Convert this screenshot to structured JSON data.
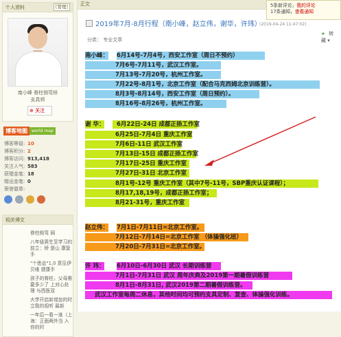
{
  "sidebar": {
    "profile_title": "个人资料",
    "manage_label": "[管理]",
    "user_caption_1": "南小峰  脊柱侧弯矫",
    "user_caption_2": "支具师",
    "follow_label": "关注",
    "blogmap_label": "博客地图",
    "blogmap_sub": "world map",
    "stats": [
      {
        "k": "博客等级:",
        "v": "10"
      },
      {
        "k": "博客积分:",
        "v": "2"
      },
      {
        "k": "博客访问:",
        "v": "913,418"
      },
      {
        "k": "关注人气:",
        "v": "583"
      },
      {
        "k": "获赠金笔:",
        "v": "18"
      },
      {
        "k": "赠出金笔:",
        "v": "0"
      },
      {
        "k": "荣誉徽章:",
        "v": ""
      }
    ],
    "related_title": "相关博文",
    "related": [
      "脊柱侧弯 网",
      "八年级男生至学习的前立：矫 是山 康复手",
      "\"个悉会\"1,0 意见伊贝维 健康手",
      "孩子的脊柱，父母需要多少了 上对心处理 与西医双",
      "大学开启新增加的时立我的视听 最新",
      "一年后一看一准（上海：正面两外当 入你的时"
    ]
  },
  "main": {
    "header_label": "正文",
    "title": "2019年7月-8月行程（南小峰，赵立伟，谢华，许玮）",
    "meta": "(2019-04-24 11:47:02)",
    "tag_label": "分类：  专业文章",
    "notice": {
      "line1a": "5条新评论，",
      "line1b": "我的评论",
      "line2a": "17条通知，",
      "line2b": "查看通知"
    }
  },
  "schedule": {
    "nan": {
      "name": "南小峰：",
      "items": [
        "6月14号-7月4号，西安工作室（周日不预约）",
        "7月6号-7月11号，武汉工作室。",
        "7月13号-7月20号，杭州工作室。",
        "7月22号-8月1号，北京工作室（配合马克西姆北京训练营）。",
        "8月3号-8月14号，西安工作室（周日预约）。",
        "8月16号-8月26号，杭州工作室。"
      ]
    },
    "xie": {
      "name": "谢  华：",
      "items": [
        "6月22日-24日  成都正扬工作室",
        "6月25日-7月4日 重庆工作室",
        "7月6日-11日  武汉工作室",
        "7月13日-15日  成都正扬工作室",
        "7月17日-25日  重庆工作室",
        "7月27日-31日  北京工作室",
        "8月1号-12号 重庆工作室（其中7号-11号，SBP重庆认证课程）；",
        "8月17,18,19号，成都正扬工作室；",
        "8月21-31号，重庆工作室"
      ]
    },
    "zhao": {
      "name": "赵立伟：",
      "items": [
        "7月1日-7月11日=北京工作室。",
        "7月12日-7月14日=北京工作室 （体操强化班）",
        "7月20日-7月31日=北京工作室。"
      ]
    },
    "xu": {
      "name": "许  玮：",
      "items": [
        "6月10日-6月30日 武汉 长期训练营",
        "7月1日-7月31日  武汉 周年庆典及2019第一期暑假训练营",
        "8月1日-8月31日,  武汉2019第二期暑假训练营。",
        "武汉工作室每周二休息，其他时间均可预约支具定制、复查、体操强化训练。"
      ]
    }
  },
  "colors": {
    "nan": "#8fd0ee",
    "xie": "#c8e81b",
    "zhao": "#f79a1a",
    "xu": "#f03af0"
  }
}
